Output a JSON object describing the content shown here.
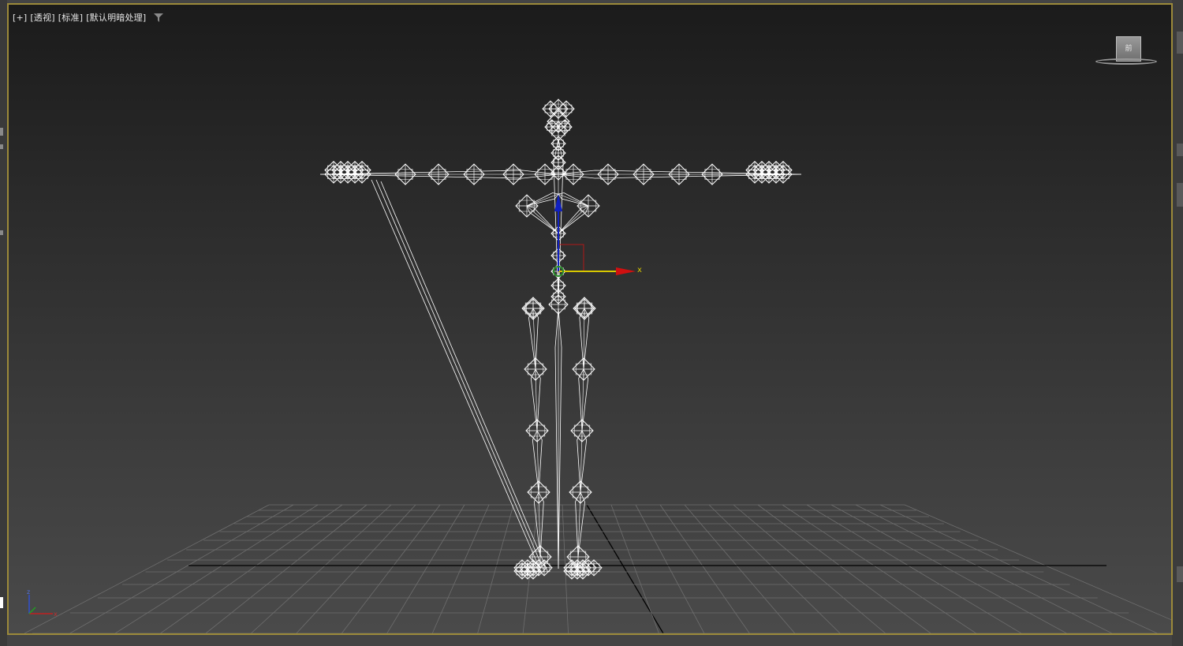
{
  "viewport": {
    "label_items": [
      "[+]",
      "[透视]",
      "[标准]",
      "[默认明暗处理]"
    ],
    "filter_icon": "funnel-filter-icon",
    "border_color": "#9c8a3a",
    "active": true
  },
  "viewcube": {
    "face_label": "前",
    "icon": "viewcube-icon"
  },
  "gizmo": {
    "x_label": "x",
    "x_axis_color": "#d01010",
    "y_axis_color": "#d8c800",
    "z_axis_color": "#1020c0"
  },
  "axis_tripod": {
    "z_label": "z",
    "x_label": "x"
  },
  "scene": {
    "object": "biped-skeleton-wireframe",
    "wire_color": "#ffffff",
    "grid_color": "#6e6e6e",
    "grid_axis_color": "#000000"
  }
}
